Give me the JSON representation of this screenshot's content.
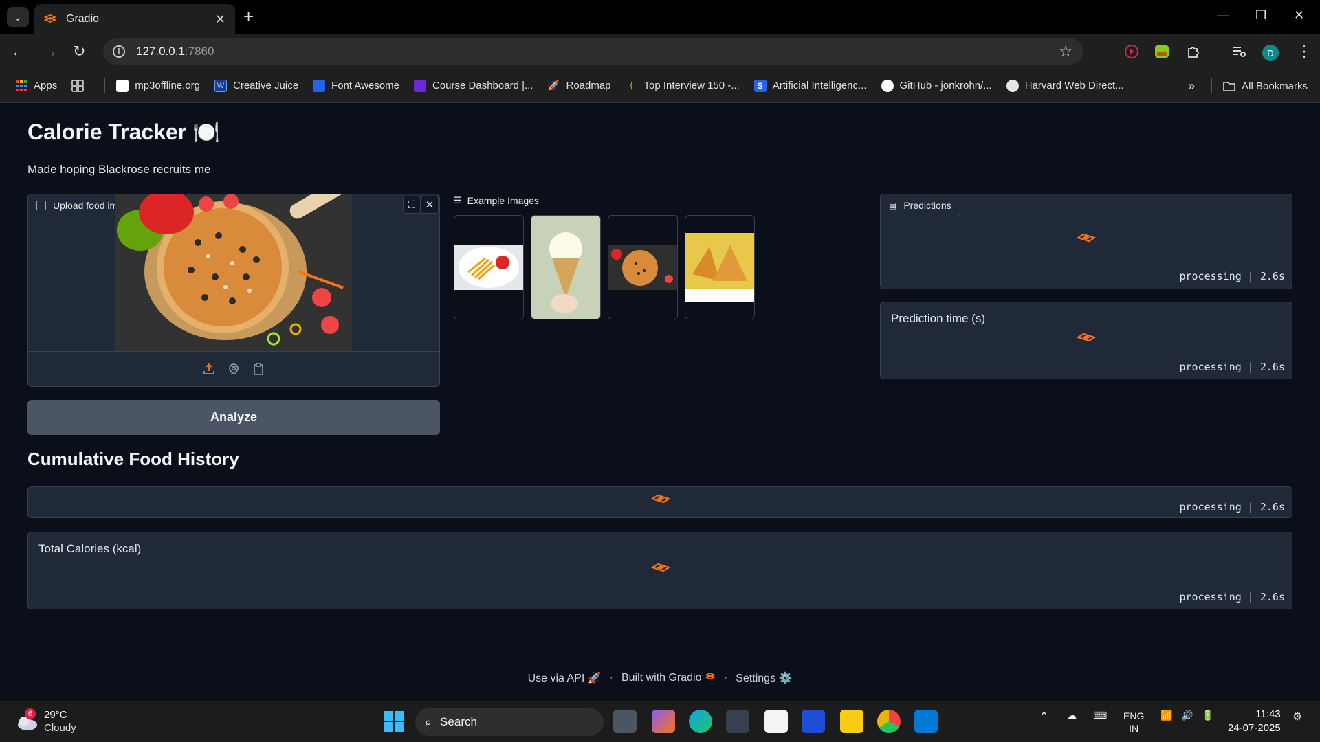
{
  "browser": {
    "tab_title": "Gradio",
    "url_host": "127.0.0.1",
    "url_port": ":7860",
    "profile_initial": "D",
    "bookmarks": [
      "Apps",
      "mp3offline.org",
      "Creative Juice",
      "Font Awesome",
      "Course Dashboard |...",
      "Roadmap",
      "Top Interview 150 -...",
      "Artificial Intelligenc...",
      "GitHub - jonkrohn/...",
      "Harvard Web Direct..."
    ],
    "all_bookmarks": "All Bookmarks",
    "overflow": "»"
  },
  "app": {
    "title": "Calorie Tracker 🍽️",
    "description": "Made hoping Blackrose recruits me",
    "upload_label": "Upload food image",
    "examples_label": "Example Images",
    "analyze_label": "Analyze",
    "predictions_label": "Predictions",
    "prediction_time_label": "Prediction time (s)",
    "history_title": "Cumulative Food History",
    "total_calories_label": "Total Calories (kcal)",
    "status": "processing | 2.6s",
    "examples": [
      "fries",
      "ice-cream",
      "pizza",
      "samosa"
    ]
  },
  "footer": {
    "api": "Use via API 🚀",
    "built": "Built with Gradio",
    "settings": "Settings ⚙️",
    "sep": "·"
  },
  "taskbar": {
    "weather_temp": "29°C",
    "weather_desc": "Cloudy",
    "weather_badge": "6",
    "search": "Search",
    "lang_top": "ENG",
    "lang_bottom": "IN",
    "time": "11:43",
    "date": "24-07-2025"
  },
  "colors": {
    "accent": "#f97316",
    "panel": "#1f2937",
    "background": "#0b0f19"
  }
}
